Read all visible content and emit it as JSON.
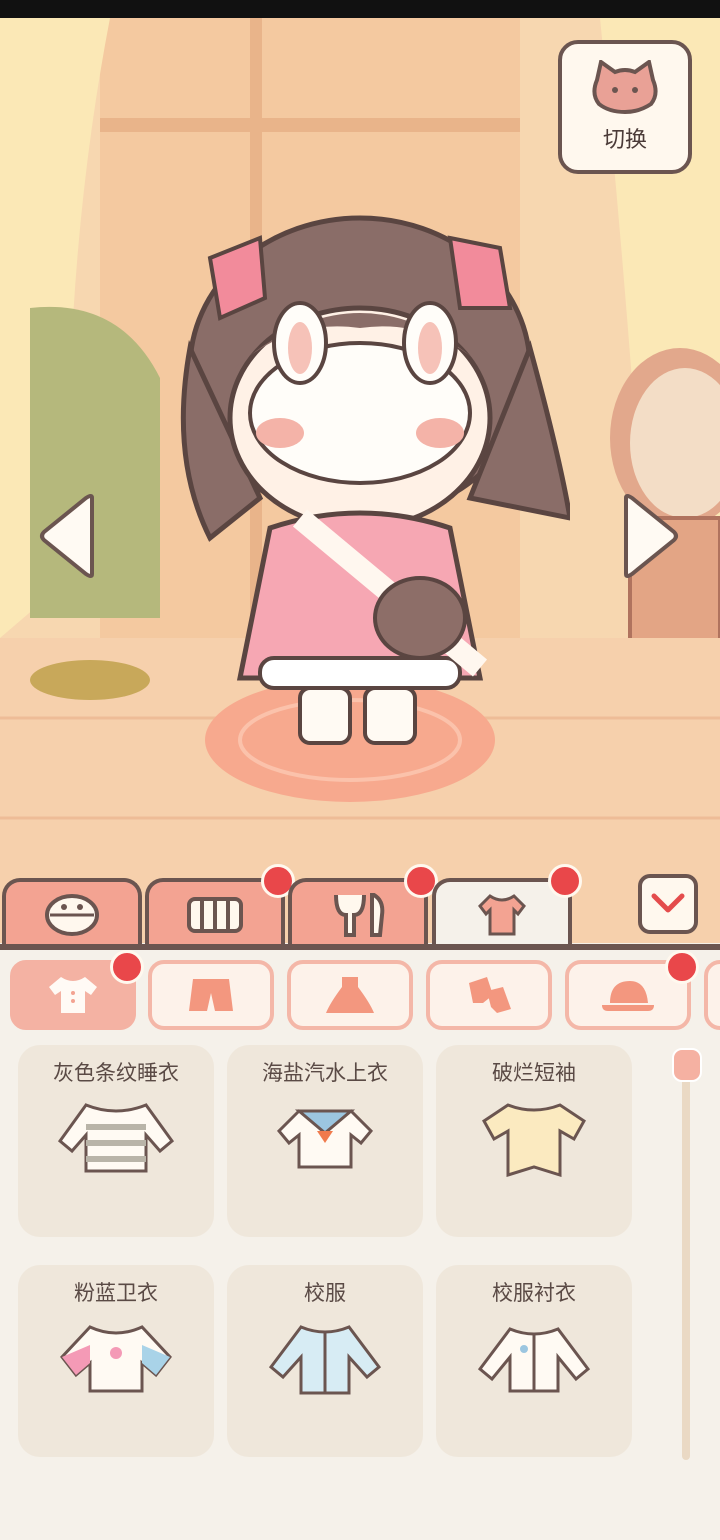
{
  "switch_button": {
    "label": "切换",
    "icon": "cat-face-icon"
  },
  "category_tabs": [
    {
      "icon": "face-icon",
      "badge": false,
      "active": false
    },
    {
      "icon": "furniture-icon",
      "badge": true,
      "active": false
    },
    {
      "icon": "food-icon",
      "badge": true,
      "active": false
    },
    {
      "icon": "shirt-icon",
      "badge": true,
      "active": true
    }
  ],
  "sub_tabs": [
    {
      "icon": "top-icon",
      "badge": true,
      "active": true
    },
    {
      "icon": "shorts-icon",
      "badge": false,
      "active": false
    },
    {
      "icon": "dress-icon",
      "badge": false,
      "active": false
    },
    {
      "icon": "socks-icon",
      "badge": false,
      "active": false
    },
    {
      "icon": "hat-icon",
      "badge": true,
      "active": false
    }
  ],
  "items": [
    {
      "name": "灰色条纹睡衣"
    },
    {
      "name": "海盐汽水上衣"
    },
    {
      "name": "破烂短袖"
    },
    {
      "name": "粉蓝卫衣"
    },
    {
      "name": "校服"
    },
    {
      "name": "校服衬衣"
    }
  ],
  "colors": {
    "accent": "#f3a392",
    "outline": "#6b5550",
    "badge": "#e9474a",
    "panel": "#f5f1ea"
  }
}
